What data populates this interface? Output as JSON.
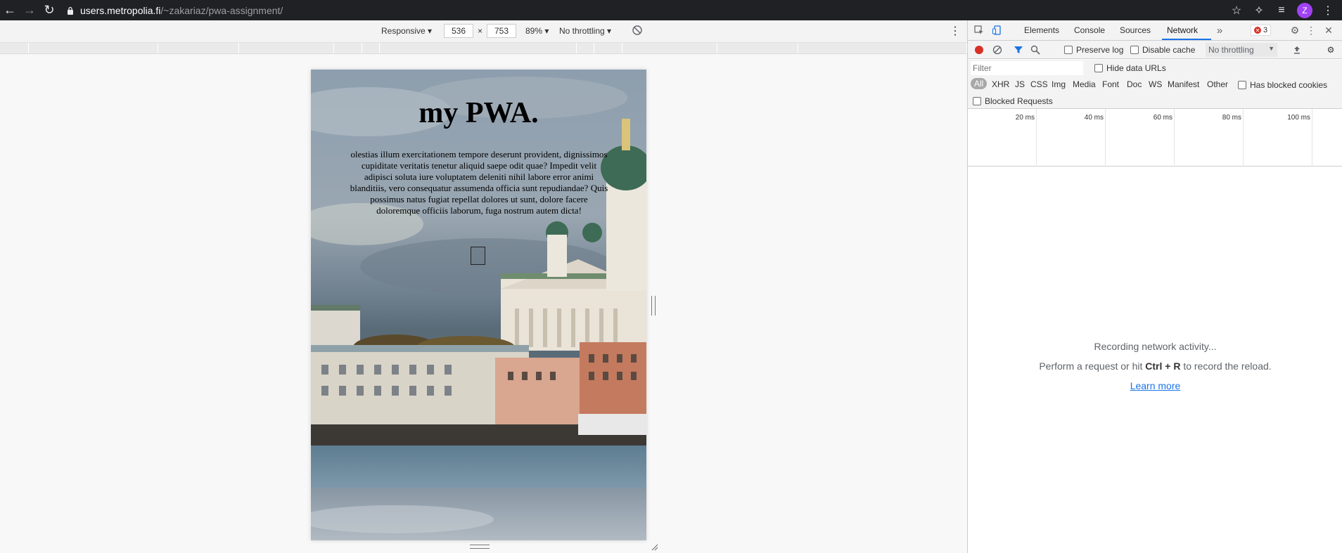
{
  "browser": {
    "url_host": "users.metropolia.fi",
    "url_path": "/~zakariaz/pwa-assignment/",
    "avatar_letter": "Z"
  },
  "device_toolbar": {
    "mode": "Responsive ▾",
    "width": "536",
    "times": "×",
    "height": "753",
    "zoom": "89% ▾",
    "throttling": "No throttling ▾"
  },
  "page": {
    "title": "my PWA.",
    "body": "olestias illum exercitationem tempore deserunt provident, dignissimos cupiditate veritatis tenetur aliquid saepe odit quae? Impedit velit adipisci soluta iure voluptatem deleniti nihil labore error animi blanditiis, vero consequatur assumenda officia sunt repudiandae? Quis possimus natus fugiat repellat dolores ut sunt, dolore facere doloremque officiis laborum, fuga nostrum autem dicta!"
  },
  "devtools": {
    "tabs": [
      "Elements",
      "Console",
      "Sources",
      "Network"
    ],
    "active_tab": "Network",
    "more": "»",
    "error_count": "3",
    "toolbar": {
      "preserve_log": "Preserve log",
      "disable_cache": "Disable cache",
      "throttling": "No throttling"
    },
    "filter": {
      "placeholder": "Filter",
      "hide_data_urls": "Hide data URLs"
    },
    "types": [
      "All",
      "XHR",
      "JS",
      "CSS",
      "Img",
      "Media",
      "Font",
      "Doc",
      "WS",
      "Manifest",
      "Other"
    ],
    "has_blocked_cookies": "Has blocked cookies",
    "blocked_requests": "Blocked Requests",
    "timeline_ticks": [
      "20 ms",
      "40 ms",
      "60 ms",
      "80 ms",
      "100 ms"
    ],
    "empty": {
      "recording": "Recording network activity...",
      "perform_prefix": "Perform a request or hit ",
      "shortcut": "Ctrl + R",
      "perform_suffix": " to record the reload.",
      "learn_more": "Learn more"
    }
  },
  "colors": {
    "chrome_dark": "#202124",
    "devtools_accent": "#1a73e8",
    "record_red": "#d93025",
    "avatar": "#a142f4"
  }
}
